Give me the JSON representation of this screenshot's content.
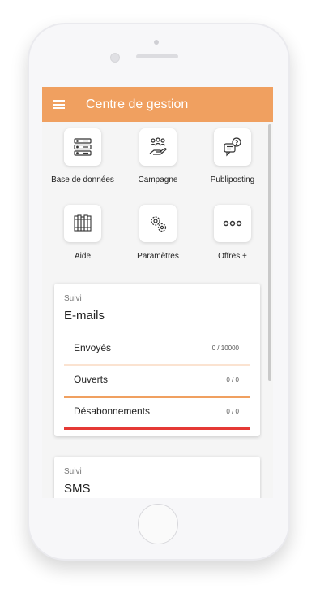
{
  "app": {
    "title": "Centre de gestion"
  },
  "menu": [
    {
      "label": "Base de données",
      "icon": "database-icon"
    },
    {
      "label": "Campagne",
      "icon": "campaign-hand-icon"
    },
    {
      "label": "Publiposting",
      "icon": "help-chat-icon"
    },
    {
      "label": "Aide",
      "icon": "book-shelf-icon"
    },
    {
      "label": "Paramètres",
      "icon": "gears-icon"
    },
    {
      "label": "Offres +",
      "icon": "more-dots-icon"
    }
  ],
  "suivi_emails": {
    "kicker": "Suivi",
    "title": "E-mails",
    "rows": [
      {
        "label": "Envoyés",
        "value": "0 / 10000",
        "color": "#fbe3d1"
      },
      {
        "label": "Ouverts",
        "value": "0 / 0",
        "color": "#f0a060"
      },
      {
        "label": "Désabonnements",
        "value": "0 / 0",
        "color": "#e53935"
      }
    ]
  },
  "suivi_sms": {
    "kicker": "Suivi",
    "title": "SMS"
  },
  "colors": {
    "accent": "#f0a060",
    "danger": "#e53935"
  }
}
